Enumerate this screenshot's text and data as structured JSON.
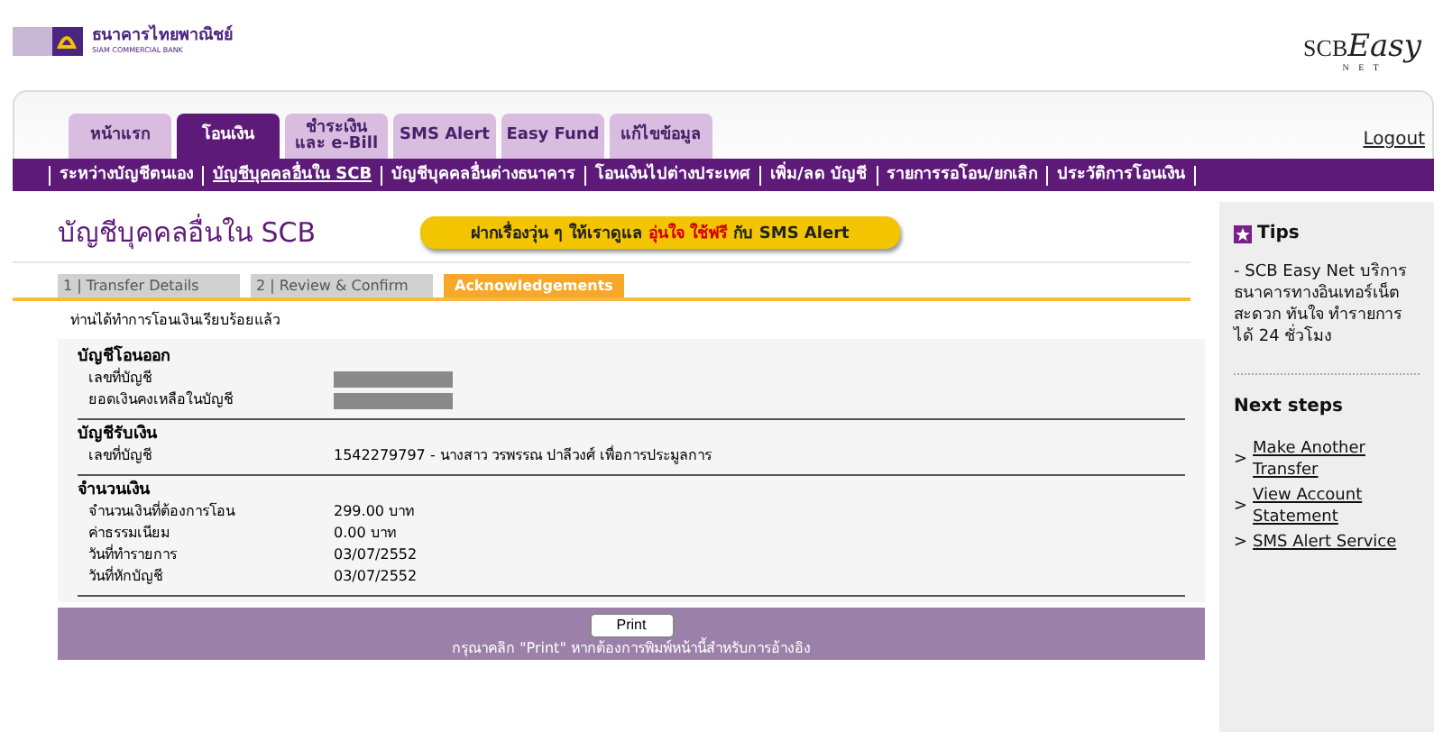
{
  "header": {
    "bank_name": "ธนาคารไทยพาณิชย์",
    "bank_name_en": "SIAM COMMERCIAL BANK",
    "brand": "SCB",
    "brand_script": "Easy",
    "brand_sub": "N E T"
  },
  "tabs": [
    {
      "label": "หน้าแรก",
      "selected": false
    },
    {
      "label": "โอนเงิน",
      "selected": true
    },
    {
      "label": "ชำระเงิน และ e-Bill",
      "selected": false
    },
    {
      "label": "SMS Alert",
      "selected": false
    },
    {
      "label": "Easy Fund",
      "selected": false
    },
    {
      "label": "แก้ไขข้อมูล",
      "selected": false
    }
  ],
  "logout": "Logout",
  "subnav": [
    {
      "label": "ระหว่างบัญชีตนเอง",
      "selected": false
    },
    {
      "label": "บัญชีบุคคลอื่นใน SCB",
      "selected": true
    },
    {
      "label": "บัญชีบุคคลอื่นต่างธนาคาร",
      "selected": false
    },
    {
      "label": "โอนเงินไปต่างประเทศ",
      "selected": false
    },
    {
      "label": "เพิ่ม/ลด บัญชี",
      "selected": false
    },
    {
      "label": "รายการรอโอน/ยกเลิก",
      "selected": false
    },
    {
      "label": "ประวัติการโอนเงิน",
      "selected": false
    }
  ],
  "page_title": "บัญชีบุคคลอื่นใน SCB",
  "banner": {
    "text": "ฝากเรื่องวุ่น ๆ ให้เราดูแล",
    "highlight": "อุ่นใจ ใช้ฟรี",
    "suffix": "กับ SMS Alert"
  },
  "steps": [
    {
      "label": "1 | Transfer Details",
      "selected": false
    },
    {
      "label": "2 | Review & Confirm",
      "selected": false
    },
    {
      "label": "Acknowledgements",
      "selected": true
    }
  ],
  "message": "ท่านได้ทำการโอนเงินเรียบร้อยแล้ว",
  "sections": [
    {
      "title": "บัญชีโอนออก",
      "rows": [
        {
          "label": "เลขที่บัญชี",
          "kind": "redacted"
        },
        {
          "label": "ยอดเงินคงเหลือในบัญชี",
          "kind": "redacted"
        }
      ]
    },
    {
      "title": "บัญชีรับเงิน",
      "rows": [
        {
          "label": "เลขที่บัญชี",
          "kind": "text",
          "value": "1542279797 - นางสาว วรพรรณ ปาลีวงศ์ เพื่อการประมูลการ"
        }
      ]
    },
    {
      "title": "จำนวนเงิน",
      "rows": [
        {
          "label": "จำนวนเงินที่ต้องการโอน",
          "kind": "text",
          "value": "299.00 บาท"
        },
        {
          "label": "ค่าธรรมเนียม",
          "kind": "text",
          "value": "0.00 บาท"
        },
        {
          "label": "วันที่ทำรายการ",
          "kind": "text",
          "value": "03/07/2552"
        },
        {
          "label": "วันที่หักบัญชี",
          "kind": "text",
          "value": "03/07/2552"
        }
      ]
    }
  ],
  "print_button": "Print",
  "print_note": "กรุณาคลิก \"Print\" หากต้องการพิมพ์หน้านี้สำหรับการอ้างอิง",
  "sidebar": {
    "tips_title": "Tips",
    "tips_text": "- SCB Easy Net บริการธนาคารทางอินเทอร์เน็ต สะดวก ทันใจ ทำรายการได้ 24 ชั่วโมง",
    "next_title": "Next steps",
    "links": [
      {
        "marker": ">",
        "label": "Make Another Transfer"
      },
      {
        "marker": ">",
        "label": "View Account Statement"
      },
      {
        "marker": ">",
        "label": "SMS Alert Service"
      }
    ]
  }
}
